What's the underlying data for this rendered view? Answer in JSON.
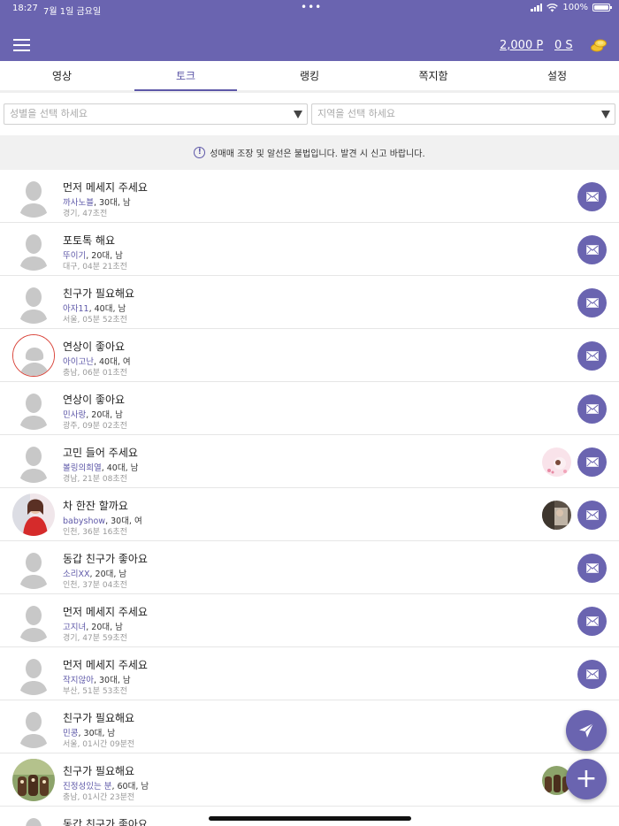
{
  "status_bar": {
    "time": "18:27",
    "date": "7월 1일 금요일",
    "dots": "•••",
    "battery": "100%"
  },
  "header": {
    "menu_icon": "hamburger-icon",
    "points": "2,000 P",
    "seconds": "0 S",
    "coin_icon": "coin-icon"
  },
  "tabs": [
    {
      "label": "영상",
      "active": false
    },
    {
      "label": "토크",
      "active": true
    },
    {
      "label": "랭킹",
      "active": false
    },
    {
      "label": "쪽지함",
      "active": false
    },
    {
      "label": "설정",
      "active": false
    }
  ],
  "filters": {
    "gender_placeholder": "성별을 선택 하세요",
    "region_placeholder": "지역을 선택 하세요"
  },
  "notice": "성매매 조장 및 알선은 불법입니다. 발견 시 신고 바랍니다.",
  "posts": [
    {
      "title": "먼저 메세지 주세요",
      "nick": "까사노블",
      "info": ", 30대, 남",
      "sub": "경기, 47초전",
      "avatar": "male",
      "thumb": null
    },
    {
      "title": "포토톡 해요",
      "nick": "뚜이기",
      "info": ", 20대, 남",
      "sub": "대구, 04분 21초전",
      "avatar": "male",
      "thumb": null
    },
    {
      "title": "친구가 필요해요",
      "nick": "아자11",
      "info": ", 40대, 남",
      "sub": "서울, 05분 52초전",
      "avatar": "male",
      "thumb": null
    },
    {
      "title": "연상이 좋아요",
      "nick": "아이고난",
      "info": ", 40대, 여",
      "sub": "충남, 06분 01초전",
      "avatar": "female",
      "thumb": null
    },
    {
      "title": "연상이 좋아요",
      "nick": "민사랑",
      "info": ", 20대, 남",
      "sub": "광주, 09분 02초전",
      "avatar": "male",
      "thumb": null
    },
    {
      "title": "고민 들어 주세요",
      "nick": "볼링의희열",
      "info": ", 40대, 남",
      "sub": "경남, 21분 08초전",
      "avatar": "male",
      "thumb": "flower"
    },
    {
      "title": "차 한잔 할까요",
      "nick": "babyshow",
      "info": ", 30대, 여",
      "sub": "인천, 36분 16초전",
      "avatar": "photo-woman",
      "thumb": "room"
    },
    {
      "title": "동갑 친구가 좋아요",
      "nick": "소리XX",
      "info": ", 20대, 남",
      "sub": "인천, 37분 04초전",
      "avatar": "male",
      "thumb": null
    },
    {
      "title": "먼저 메세지 주세요",
      "nick": "고지녀",
      "info": ", 20대, 남",
      "sub": "경기, 47분 59초전",
      "avatar": "male",
      "thumb": null
    },
    {
      "title": "먼저 메세지 주세요",
      "nick": "작지않아",
      "info": ", 30대, 남",
      "sub": "부산, 51분 53초전",
      "avatar": "male",
      "thumb": null
    },
    {
      "title": "친구가 필요해요",
      "nick": "민콩",
      "info": ", 30대, 남",
      "sub": "서울, 01시간 09분전",
      "avatar": "male",
      "thumb": null,
      "mail": false
    },
    {
      "title": "친구가 필요해요",
      "nick": "진정성있는 분",
      "info": ", 60대, 남",
      "sub": "충남, 01시간 23분전",
      "avatar": "photo-group",
      "thumb": "group",
      "mail": false
    },
    {
      "title": "동갑 친구가 좋아요",
      "nick": "",
      "info": "",
      "sub": "",
      "avatar": "male",
      "thumb": null,
      "mail": false
    }
  ],
  "fab": {
    "send_icon": "paper-plane-icon",
    "add_label": "+"
  }
}
